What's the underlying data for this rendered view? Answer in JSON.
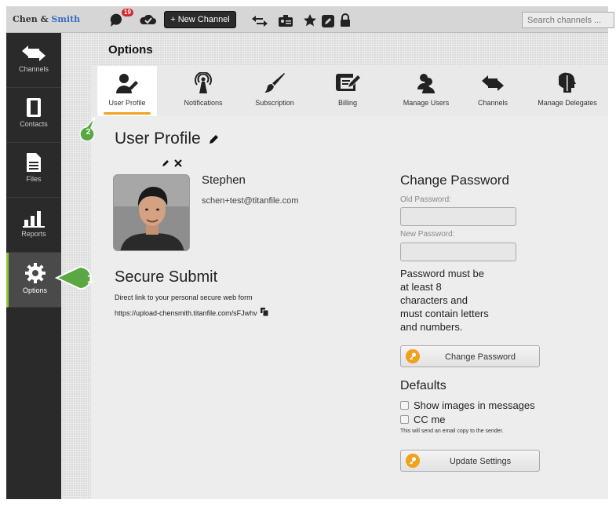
{
  "brand": {
    "part1": "Chen & ",
    "part2": "Smith"
  },
  "topbar": {
    "notification_count": "19",
    "new_channel_label": "+ New Channel",
    "search_placeholder": "Search channels ..."
  },
  "sidebar": {
    "items": [
      {
        "label": "Channels",
        "icon": "channels-arrows-icon"
      },
      {
        "label": "Contacts",
        "icon": "contacts-book-icon"
      },
      {
        "label": "Files",
        "icon": "file-icon"
      },
      {
        "label": "Reports",
        "icon": "bar-chart-icon"
      },
      {
        "label": "Options",
        "icon": "gear-icon",
        "active": true
      }
    ]
  },
  "options": {
    "title": "Options"
  },
  "tabs": [
    {
      "label": "User Profile",
      "icon": "user-edit-icon",
      "active": true
    },
    {
      "label": "Notifications",
      "icon": "broadcast-icon"
    },
    {
      "label": "Subscription",
      "icon": "brush-icon"
    },
    {
      "label": "Billing",
      "icon": "billing-edit-icon"
    },
    {
      "label": "Manage Users",
      "icon": "users-icon"
    },
    {
      "label": "Channels",
      "icon": "channels-arrows-icon"
    },
    {
      "label": "Manage Delegates",
      "icon": "delegate-head-icon"
    }
  ],
  "profile": {
    "title": "User Profile",
    "name": "Stephen",
    "email": "schen+test@titanfile.com"
  },
  "secure_submit": {
    "title": "Secure Submit",
    "description": "Direct link to your personal secure web form",
    "link": "https://upload-chensmith.titanfile.com/sFJwhv"
  },
  "change_password": {
    "title": "Change Password",
    "old_label": "Old Password:",
    "new_label": "New Password:",
    "rule_lines": [
      "Password must be",
      "at least 8",
      "characters and",
      "must contain letters",
      "and numbers."
    ],
    "button_label": "Change Password"
  },
  "defaults": {
    "title": "Defaults",
    "show_images_label": "Show images in messages",
    "cc_me_label": "CC me",
    "cc_note": "This will send an email copy to the sender.",
    "update_button_label": "Update Settings"
  },
  "callouts": {
    "step1": "1",
    "step2": "2"
  },
  "colors": {
    "accent": "#f0a11e",
    "callout_green": "#5aa743",
    "sidebar_bg": "#2a2a2a",
    "active_bar": "#8ac43f"
  }
}
